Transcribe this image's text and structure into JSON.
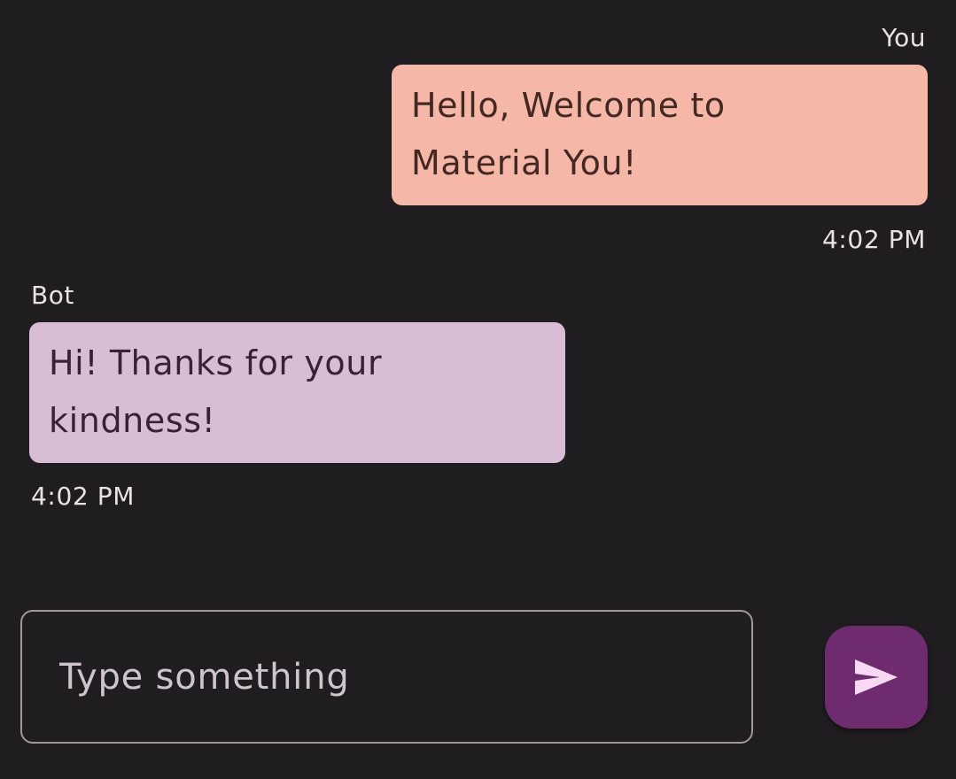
{
  "messages": [
    {
      "sender": "You",
      "lines": [
        "Hello, Welcome to",
        "Material You!"
      ],
      "time": "4:02 PM"
    },
    {
      "sender": "Bot",
      "lines": [
        "Hi! Thanks for your",
        "kindness!"
      ],
      "time": "4:02 PM"
    }
  ],
  "composer": {
    "placeholder": "Type something",
    "value": "",
    "send_icon": "send-icon"
  },
  "colors": {
    "background": "#1f1d1f",
    "you_bubble": "#f5b8a8",
    "bot_bubble": "#d9bdd4",
    "send_button": "#6e2b6e",
    "send_icon": "#f8d8f2"
  }
}
